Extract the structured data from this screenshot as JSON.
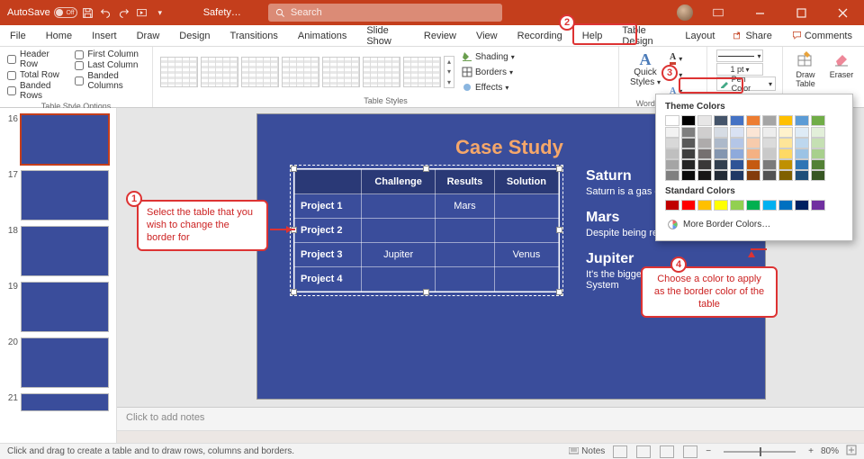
{
  "title_bar": {
    "autosave_label": "AutoSave",
    "autosave_state": "Off",
    "filename": "Safety…",
    "search_placeholder": "Search"
  },
  "tabs": {
    "file": "File",
    "home": "Home",
    "insert": "Insert",
    "draw": "Draw",
    "design": "Design",
    "transitions": "Transitions",
    "animations": "Animations",
    "slideshow": "Slide Show",
    "review": "Review",
    "view": "View",
    "recording": "Recording",
    "help": "Help",
    "table_design": "Table Design",
    "layout": "Layout",
    "share": "Share",
    "comments": "Comments"
  },
  "ribbon": {
    "style_options": {
      "header_row": "Header Row",
      "first_col": "First Column",
      "total_row": "Total Row",
      "last_col": "Last Column",
      "banded_rows": "Banded Rows",
      "banded_cols": "Banded Columns",
      "group": "Table Style Options"
    },
    "table_styles_group": "Table Styles",
    "shading": "Shading",
    "borders": "Borders",
    "effects": "Effects",
    "wordart": {
      "quick": "Quick",
      "styles": "Styles",
      "group": "WordArt Styles"
    },
    "pen_color": "Pen Color",
    "pen_width": "1 pt",
    "draw_table": "Draw\nTable",
    "eraser": "Eraser"
  },
  "thumbs": [
    {
      "n": "16"
    },
    {
      "n": "17"
    },
    {
      "n": "18"
    },
    {
      "n": "19"
    },
    {
      "n": "20"
    },
    {
      "n": "21"
    }
  ],
  "slide": {
    "title": "Case Study",
    "headers": [
      "",
      "Challenge",
      "Results",
      "Solution"
    ],
    "rows": [
      {
        "rh": "Project 1",
        "c": [
          "",
          "Mars",
          ""
        ]
      },
      {
        "rh": "Project 2",
        "c": [
          "",
          "",
          ""
        ]
      },
      {
        "rh": "Project 3",
        "c": [
          "Jupiter",
          "",
          "Venus"
        ]
      },
      {
        "rh": "Project 4",
        "c": [
          "",
          "",
          ""
        ]
      }
    ],
    "side": [
      {
        "name": "Saturn",
        "desc": "Saturn is a gas giant and has rings"
      },
      {
        "name": "Mars",
        "desc": "Despite being red, Mars is cold"
      },
      {
        "name": "Jupiter",
        "desc": "It's the biggest planet in the Solar System"
      }
    ]
  },
  "notes_placeholder": "Click to add notes",
  "pen_dropdown": {
    "theme_label": "Theme Colors",
    "standard_label": "Standard Colors",
    "more": "More Border Colors…",
    "theme_top": [
      "#ffffff",
      "#000000",
      "#e7e6e6",
      "#44546a",
      "#4472c4",
      "#ed7d31",
      "#a5a5a5",
      "#ffc000",
      "#5b9bd5",
      "#70ad47"
    ],
    "theme_shades": [
      [
        "#f2f2f2",
        "#7f7f7f",
        "#d0cece",
        "#d6dce4",
        "#d9e2f3",
        "#fbe5d5",
        "#ededed",
        "#fff2cc",
        "#deebf6",
        "#e2efd9"
      ],
      [
        "#d8d8d8",
        "#595959",
        "#aeabab",
        "#adb9ca",
        "#b4c6e7",
        "#f7cbac",
        "#dbdbdb",
        "#fee599",
        "#bdd7ee",
        "#c5e0b3"
      ],
      [
        "#bfbfbf",
        "#3f3f3f",
        "#757070",
        "#8496b0",
        "#8eaadb",
        "#f4b183",
        "#c9c9c9",
        "#ffd965",
        "#9cc3e5",
        "#a8d08d"
      ],
      [
        "#a5a5a5",
        "#262626",
        "#3a3838",
        "#323f4f",
        "#2f5496",
        "#c55a11",
        "#7b7b7b",
        "#bf9000",
        "#2e75b5",
        "#538135"
      ],
      [
        "#7f7f7f",
        "#0c0c0c",
        "#171616",
        "#222a35",
        "#1f3864",
        "#833c0b",
        "#525252",
        "#7f6000",
        "#1e4e79",
        "#375623"
      ]
    ],
    "standard": [
      "#c00000",
      "#ff0000",
      "#ffc000",
      "#ffff00",
      "#92d050",
      "#00b050",
      "#00b0f0",
      "#0070c0",
      "#002060",
      "#7030a0"
    ]
  },
  "callouts": {
    "c1": "Select the table that you wish to change the border for",
    "c4": "Choose a color to apply as the border color of the table"
  },
  "status": {
    "left": "Click and drag to create a table and to draw rows, columns and borders.",
    "notes_btn": "Notes",
    "zoom": "80%"
  }
}
